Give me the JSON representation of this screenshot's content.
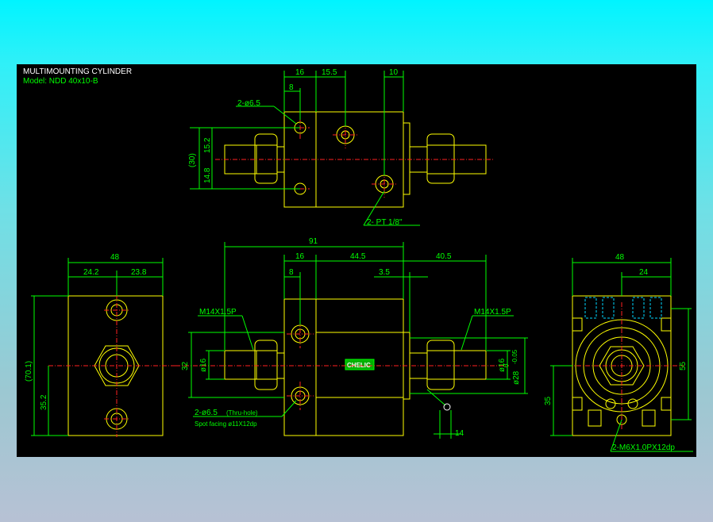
{
  "title_block": {
    "title": "MULTIMOUNTING CYLINDER",
    "model": "Model: NDD 40x10-B"
  },
  "top_view": {
    "dim_16": "16",
    "dim_15_5": "15.5",
    "dim_10": "10",
    "dim_8": "8",
    "hole_label": "2-ø6.5",
    "dim_30": "(30)",
    "dim_15_2": "15.2",
    "dim_14_8": "14.8",
    "port_label": "2- PT 1/8\""
  },
  "left_view": {
    "dim_48": "48",
    "dim_24_2": "24.2",
    "dim_23_8": "23.8",
    "dim_70_1": "(70.1)",
    "dim_35_2": "35.2"
  },
  "front_view": {
    "dim_91": "91",
    "dim_16": "16",
    "dim_44_5": "44.5",
    "dim_40_5": "40.5",
    "dim_8": "8",
    "dim_3_5": "3.5",
    "thread_left": "M14X1.5P",
    "thread_right": "M14X1.5P",
    "dim_32": "32",
    "dia_16_left": "ø16",
    "dia_16_right": "ø16",
    "dia_28": "ø28",
    "tol_upper": "0",
    "tol_lower": "-0.05",
    "hole_note_1": "2-ø6.5",
    "hole_note_1b": "(Thru-hole)",
    "hole_note_2": "Spot facing  ø11X12dp",
    "dim_14": "14",
    "badge": "CHELIC"
  },
  "right_view": {
    "dim_48": "48",
    "dim_24": "24",
    "dim_55": "55",
    "dim_35": "35",
    "thread_note": "2-M6X1.0PX12dp"
  }
}
